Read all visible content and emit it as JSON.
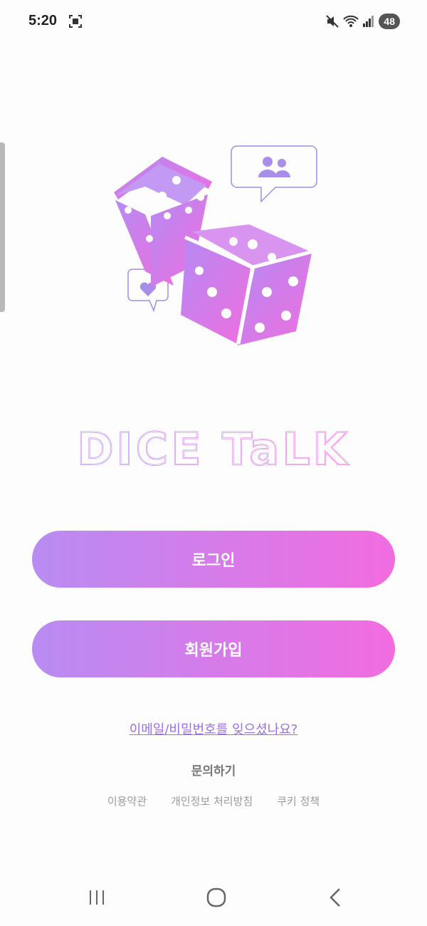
{
  "status_bar": {
    "time": "5:20",
    "battery": "48",
    "icons": [
      "screenshot-icon",
      "mute-icon",
      "wifi-icon",
      "signal-icon"
    ]
  },
  "app": {
    "name": "DICE TaLK"
  },
  "buttons": {
    "login": "로그인",
    "signup": "회원가입"
  },
  "links": {
    "forgot": "이메일/비밀번호를 잊으셨나요?",
    "contact": "문의하기",
    "footer": [
      "이용약관",
      "개인정보 처리방침",
      "쿠키 정책"
    ]
  },
  "colors": {
    "gradient_start": "#b88cf2",
    "gradient_end": "#f26ce0",
    "link": "#9b6fe6"
  },
  "nav": [
    "recents-icon",
    "home-icon",
    "back-icon"
  ]
}
